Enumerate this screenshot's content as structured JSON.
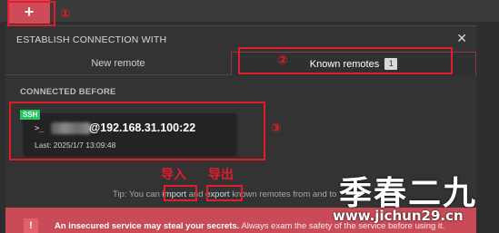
{
  "app": {
    "new_button_symbol": "+",
    "accent_color": "#cf4b5a"
  },
  "dialog": {
    "title": "ESTABLISH CONNECTION WITH",
    "close_symbol": "✕",
    "tabs": {
      "new_remote": "New remote",
      "known_remotes": "Known remotes",
      "known_count": "1"
    },
    "connected_before_label": "CONNECTED BEFORE",
    "remote": {
      "protocol_badge": "SSH",
      "prompt": ">_",
      "host": "@192.168.31.100:22",
      "last_connected": "Last: 2025/1/7 13:09:48"
    },
    "tip": {
      "prefix": "Tip: You can",
      "import": "import",
      "and": "and",
      "export": "export",
      "suffix": "known remotes from and to"
    },
    "warning": {
      "icon_symbol": "!",
      "bold_text": "An insecured service may steal your secrets.",
      "rest_text": "Always exam the safety of the service before using it."
    }
  },
  "annotations": {
    "circle_1": "①",
    "circle_2": "②",
    "circle_3": "③",
    "import_label": "导入",
    "export_label": "导出",
    "color": "#e11d2b"
  },
  "watermark": {
    "title": "季春二九",
    "url": "www.jichun29.cn"
  }
}
